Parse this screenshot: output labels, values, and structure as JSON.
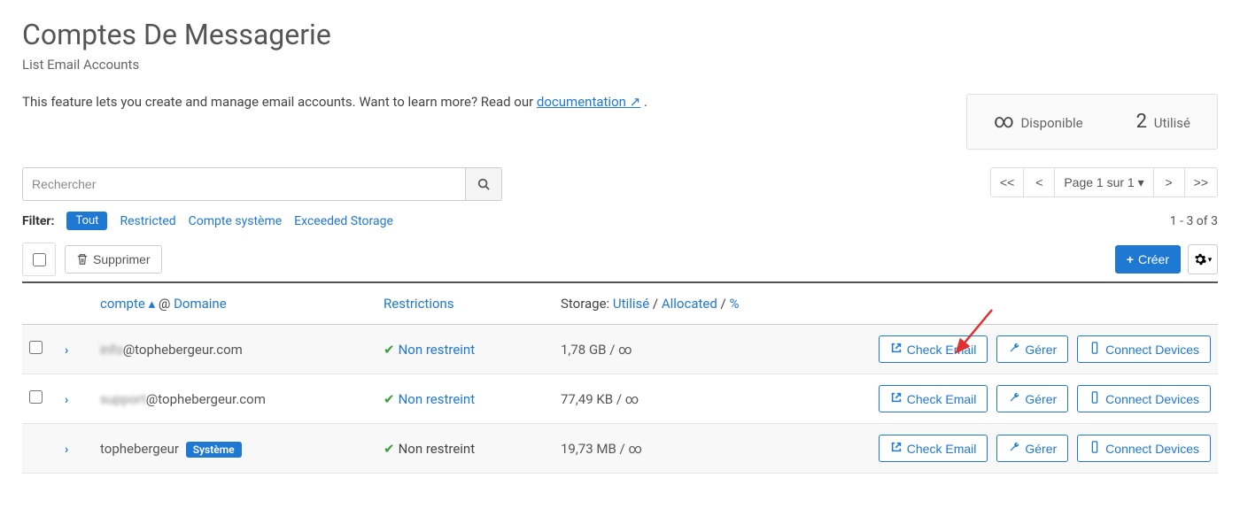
{
  "header": {
    "title": "Comptes De Messagerie",
    "subtitle": "List Email Accounts"
  },
  "description": {
    "text_prefix": "This feature lets you create and manage email accounts. Want to learn more? Read our ",
    "link_text": "documentation",
    "text_suffix": " ."
  },
  "stats": {
    "available_symbol": "∞",
    "available_label": "Disponible",
    "used_count": "2",
    "used_label": "Utilisé"
  },
  "search": {
    "placeholder": "Rechercher"
  },
  "pagination": {
    "first": "<<",
    "prev": "<",
    "page_label": "Page 1 sur 1",
    "next": ">",
    "last": ">>"
  },
  "filter": {
    "label": "Filter:",
    "all": "Tout",
    "restricted": "Restricted",
    "system": "Compte système",
    "exceeded": "Exceeded Storage"
  },
  "count_text": "1 - 3 of 3",
  "actions": {
    "delete": "Supprimer",
    "create": "Créer"
  },
  "columns": {
    "account": "compte",
    "domain_sep": " @ ",
    "domain": "Domaine",
    "restrictions": "Restrictions",
    "storage_prefix": "Storage: ",
    "storage_used": "Utilisé",
    "storage_sep1": " / ",
    "storage_allocated": "Allocated",
    "storage_sep2": " / ",
    "storage_percent": "%"
  },
  "row_buttons": {
    "check_email": "Check Email",
    "manage": "Gérer",
    "connect": "Connect Devices"
  },
  "rows": [
    {
      "local_blurred": "info",
      "email_suffix": "@tophebergeur.com",
      "restriction": "Non restreint",
      "restriction_link": true,
      "storage": "1,78 GB / ∞",
      "has_checkbox": true,
      "system": false
    },
    {
      "local_blurred": "support",
      "email_suffix": "@tophebergeur.com",
      "restriction": "Non restreint",
      "restriction_link": true,
      "storage": "77,49 KB / ∞",
      "has_checkbox": true,
      "system": false
    },
    {
      "local_blurred": "",
      "email_suffix": "tophebergeur",
      "restriction": "Non restreint",
      "restriction_link": false,
      "storage": "19,73 MB / ∞",
      "has_checkbox": false,
      "system": true,
      "system_badge": "Système"
    }
  ]
}
